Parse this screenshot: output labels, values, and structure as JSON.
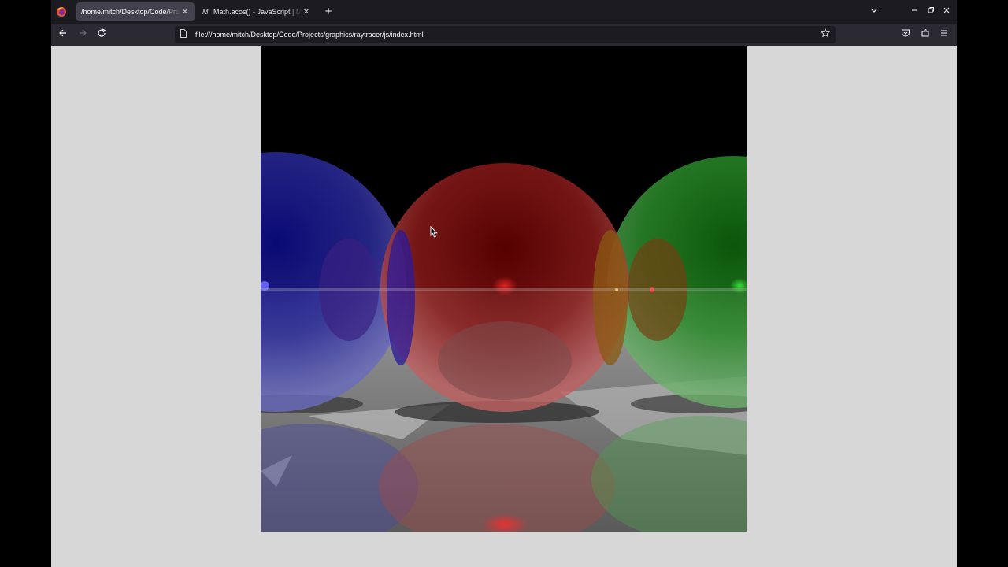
{
  "tabs": [
    {
      "title": "/home/mitch/Desktop/Code/Projects/graphics/raytracer/js/index.html",
      "active": true
    },
    {
      "favicon": "M",
      "title": "Math.acos() - JavaScript | MDN",
      "active": false
    }
  ],
  "url": "file:///home/mitch/Desktop/Code/Projects/graphics/raytracer/js/index.html",
  "icons": {
    "app": "firefox-icon",
    "back": "back-arrow-icon",
    "forward": "forward-arrow-icon",
    "reload": "reload-icon",
    "page": "page-icon",
    "bookmark": "star-icon",
    "pocket": "pocket-icon",
    "extensions": "extensions-icon",
    "menu": "hamburger-menu-icon"
  },
  "colors": {
    "background": "#d7d7d7",
    "tab_active": "#42414d",
    "toolbar": "#2b2a33"
  }
}
